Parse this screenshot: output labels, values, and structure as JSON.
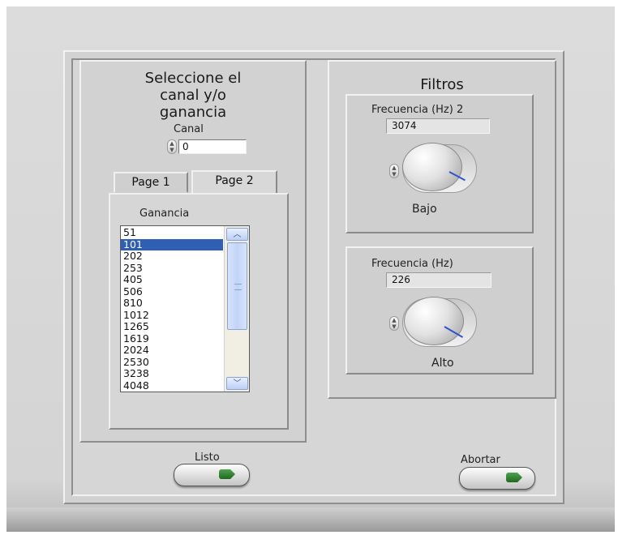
{
  "left": {
    "title_line1": "Seleccione el",
    "title_line2": "canal y/o",
    "title_line3": "ganancia",
    "canal_label": "Canal",
    "canal_value": "0",
    "tabs": [
      "Page 1",
      "Page 2"
    ],
    "active_tab": "Page 2",
    "ganancia_label": "Ganancia",
    "ganancia_items": [
      "51",
      "101",
      "202",
      "253",
      "405",
      "506",
      "810",
      "1012",
      "1265",
      "1619",
      "2024",
      "2530",
      "3238",
      "4048"
    ],
    "selected_item": "101"
  },
  "right": {
    "title": "Filtros",
    "low": {
      "label": "Frecuencia (Hz) 2",
      "value": "3074",
      "knob_label": "Bajo"
    },
    "high": {
      "label": "Frecuencia (Hz)",
      "value": "226",
      "knob_label": "Alto"
    }
  },
  "buttons": {
    "ok": "Listo",
    "abort": "Abortar"
  },
  "colors": {
    "selection": "#2f5fb5",
    "needle": "#2d55c9",
    "led": "#2e8b2e"
  }
}
